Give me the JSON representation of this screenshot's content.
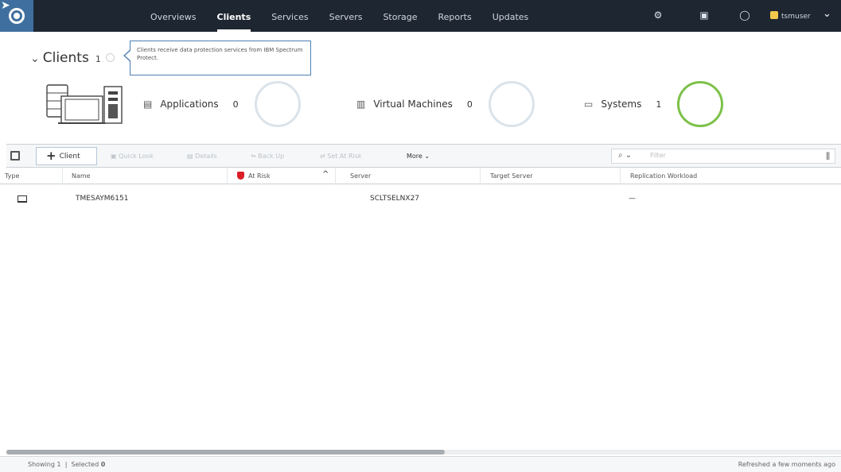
{
  "topnav": {
    "tabs": [
      {
        "label": "Overviews"
      },
      {
        "label": "Clients"
      },
      {
        "label": "Services"
      },
      {
        "label": "Servers"
      },
      {
        "label": "Storage"
      },
      {
        "label": "Reports"
      },
      {
        "label": "Updates"
      }
    ],
    "active_tab": "Clients",
    "icons": [
      "gear-icon",
      "clipboard-icon",
      "help-icon",
      "user-icon",
      "chevron-down-icon"
    ],
    "username": "tsmuser"
  },
  "header": {
    "title": "Clients",
    "count": "1",
    "tooltip": "Clients receive data protection services from IBM Spectrum Protect."
  },
  "summary": [
    {
      "label": "Applications",
      "value": "0",
      "icon": "server-rack-icon"
    },
    {
      "label": "Virtual Machines",
      "value": "0",
      "icon": "vm-icon"
    },
    {
      "label": "Systems",
      "value": "1",
      "icon": "laptop-icon"
    }
  ],
  "toolbar": {
    "add_label": "Client",
    "quick_look": "Quick Look",
    "details": "Details",
    "back_up": "Back Up",
    "set_at_risk": "Set At Risk",
    "more": "More",
    "filter_placeholder": "Filter"
  },
  "table": {
    "columns": [
      "Type",
      "Name",
      "At Risk",
      "Server",
      "Target Server",
      "Replication Workload"
    ],
    "rows": [
      {
        "name": "TMESAYM6151",
        "server": "SCLTSELNX27",
        "replication": "—"
      }
    ]
  },
  "status": {
    "showing_label": "Showing",
    "showing_value": "1",
    "selected_label": "Selected",
    "selected_value": "0",
    "refreshed": "Refreshed a few moments ago"
  },
  "colors": {
    "topbar": "#1e2631",
    "logo_bg": "#3f6f9e",
    "ring_empty": "#dbe3ea",
    "ring_systems": "#7cc149",
    "at_risk": "#da1e28"
  }
}
